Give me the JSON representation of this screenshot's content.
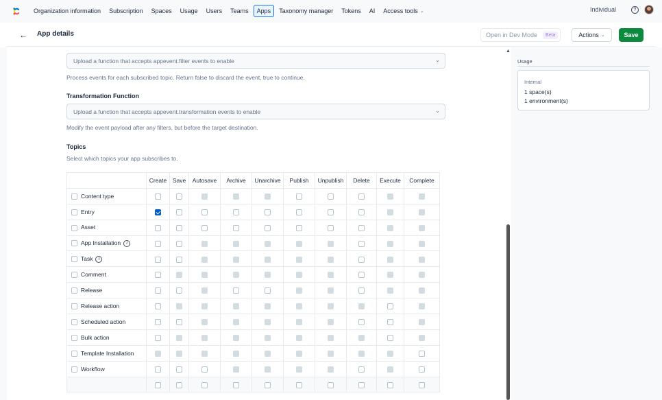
{
  "topnav": {
    "items": [
      {
        "label": "Organization information"
      },
      {
        "label": "Subscription"
      },
      {
        "label": "Spaces"
      },
      {
        "label": "Usage"
      },
      {
        "label": "Users"
      },
      {
        "label": "Teams"
      },
      {
        "label": "Apps",
        "active": true
      },
      {
        "label": "Taxonomy manager"
      },
      {
        "label": "Tokens"
      },
      {
        "label": "AI"
      },
      {
        "label": "Access tools"
      }
    ],
    "org_name": "Individual",
    "help_glyph": "?"
  },
  "header": {
    "title": "App details",
    "dev_mode_label": "Open in Dev Mode",
    "beta_label": "Beta",
    "actions_label": "Actions",
    "save_label": "Save"
  },
  "form": {
    "filter_select_placeholder": "Upload a function that accepts appevent.filter events to enable",
    "filter_help": "Process events for each subscribed topic. Return false to discard the event, true to continue.",
    "transformation_label": "Transformation Function",
    "transformation_select_placeholder": "Upload a function that accepts appevent.transformation events to enable",
    "transformation_help": "Modify the event payload after any filters, but before the target destination.",
    "topics_label": "Topics",
    "topics_help": "Select which topics your app subscribes to."
  },
  "topics_table": {
    "columns": [
      "Create",
      "Save",
      "Autosave",
      "Archive",
      "Unarchive",
      "Publish",
      "Unpublish",
      "Delete",
      "Execute",
      "Complete"
    ],
    "rows": [
      {
        "name": "Content type",
        "info": false,
        "cells": [
          "e",
          "e",
          "d",
          "d",
          "d",
          "e",
          "e",
          "e",
          "d",
          "d"
        ]
      },
      {
        "name": "Entry",
        "info": false,
        "cells": [
          "c",
          "e",
          "e",
          "e",
          "e",
          "e",
          "e",
          "e",
          "d",
          "d"
        ]
      },
      {
        "name": "Asset",
        "info": false,
        "cells": [
          "e",
          "e",
          "e",
          "e",
          "e",
          "e",
          "e",
          "e",
          "d",
          "d"
        ]
      },
      {
        "name": "App Installation",
        "info": true,
        "cells": [
          "e",
          "e",
          "d",
          "d",
          "d",
          "d",
          "d",
          "e",
          "d",
          "d"
        ]
      },
      {
        "name": "Task",
        "info": true,
        "cells": [
          "e",
          "e",
          "d",
          "d",
          "d",
          "d",
          "d",
          "e",
          "d",
          "d"
        ]
      },
      {
        "name": "Comment",
        "info": false,
        "cells": [
          "e",
          "d",
          "d",
          "d",
          "d",
          "d",
          "d",
          "e",
          "d",
          "d"
        ]
      },
      {
        "name": "Release",
        "info": false,
        "cells": [
          "e",
          "e",
          "d",
          "e",
          "e",
          "d",
          "d",
          "e",
          "d",
          "d"
        ]
      },
      {
        "name": "Release action",
        "info": false,
        "cells": [
          "e",
          "d",
          "d",
          "d",
          "d",
          "d",
          "d",
          "d",
          "e",
          "d"
        ]
      },
      {
        "name": "Scheduled action",
        "info": false,
        "cells": [
          "e",
          "e",
          "d",
          "d",
          "d",
          "d",
          "d",
          "e",
          "e",
          "d"
        ]
      },
      {
        "name": "Bulk action",
        "info": false,
        "cells": [
          "e",
          "d",
          "d",
          "d",
          "d",
          "d",
          "d",
          "d",
          "e",
          "d"
        ]
      },
      {
        "name": "Template Installation",
        "info": false,
        "cells": [
          "d",
          "d",
          "d",
          "d",
          "d",
          "d",
          "d",
          "d",
          "d",
          "e"
        ]
      },
      {
        "name": "Workflow",
        "info": false,
        "cells": [
          "e",
          "e",
          "e",
          "d",
          "d",
          "d",
          "d",
          "e",
          "d",
          "e"
        ]
      }
    ],
    "footer_cells": [
      "e",
      "e",
      "e",
      "e",
      "e",
      "e",
      "e",
      "e",
      "e",
      "e"
    ],
    "info_glyph": "i"
  },
  "sidebar": {
    "usage_title": "Usage",
    "usage_label": "Internal",
    "spaces_text": "1 space(s)",
    "environments_text": "1 environment(s)"
  }
}
